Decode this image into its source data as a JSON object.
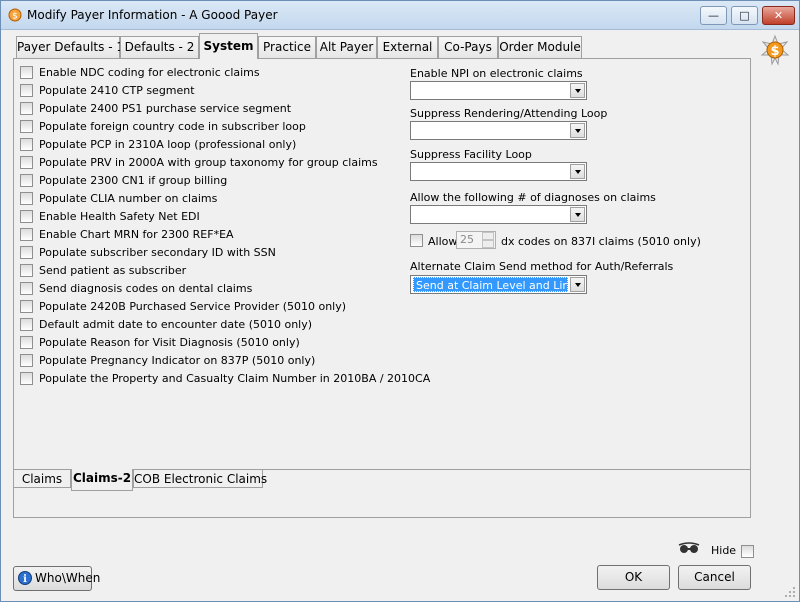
{
  "window": {
    "title": "Modify Payer Information - A Goood Payer"
  },
  "tabs": [
    {
      "label": "Payer Defaults - 1"
    },
    {
      "label": "Defaults - 2"
    },
    {
      "label": "System"
    },
    {
      "label": "Practice"
    },
    {
      "label": "Alt Payer"
    },
    {
      "label": "External"
    },
    {
      "label": "Co-Pays"
    },
    {
      "label": "Order Module"
    }
  ],
  "checkboxes": [
    {
      "label": "Enable NDC coding for electronic claims",
      "checked": false
    },
    {
      "label": "Populate 2410 CTP segment",
      "checked": false
    },
    {
      "label": "Populate 2400 PS1 purchase service segment",
      "checked": false
    },
    {
      "label": "Populate foreign country code in subscriber loop",
      "checked": false
    },
    {
      "label": "Populate PCP in 2310A loop (professional only)",
      "checked": false
    },
    {
      "label": "Populate PRV in 2000A with group taxonomy for group claims",
      "checked": false
    },
    {
      "label": "Populate 2300 CN1 if group billing",
      "checked": false
    },
    {
      "label": "Populate CLIA number on claims",
      "checked": false
    },
    {
      "label": "Enable Health Safety Net EDI",
      "checked": false
    },
    {
      "label": "Enable Chart MRN for 2300 REF*EA",
      "checked": false
    },
    {
      "label": "Populate subscriber secondary ID with SSN",
      "checked": false
    },
    {
      "label": "Send patient as subscriber",
      "checked": false
    },
    {
      "label": "Send diagnosis codes on dental claims",
      "checked": false
    },
    {
      "label": "Populate 2420B Purchased Service Provider (5010 only)",
      "checked": false
    },
    {
      "label": "Default admit date to encounter date (5010 only)",
      "checked": false
    },
    {
      "label": "Populate Reason for Visit Diagnosis (5010 only)",
      "checked": false
    },
    {
      "label": "Populate Pregnancy Indicator on 837P (5010 only)",
      "checked": false
    },
    {
      "label": "Populate the Property and Casualty Claim Number in  2010BA / 2010CA",
      "checked": false
    }
  ],
  "right": {
    "npi_label": "Enable NPI on electronic claims",
    "npi_value": "",
    "rendering_label": "Suppress Rendering/Attending Loop",
    "rendering_value": "",
    "facility_label": "Suppress Facility Loop",
    "facility_value": "",
    "diagnoses_label": "Allow the following # of diagnoses on claims",
    "diagnoses_value": "",
    "allow_label": "Allow",
    "allow_value": "25",
    "allow_suffix": "dx codes on 837I claims (5010 only)",
    "alt_send_label": "Alternate Claim Send method for Auth/Referrals",
    "alt_send_value": "Send at Claim Level and Line L"
  },
  "bottom_tabs": [
    {
      "label": "Claims"
    },
    {
      "label": "Claims-2"
    },
    {
      "label": "COB Electronic Claims"
    }
  ],
  "footer": {
    "who_when": "Who\\When",
    "hide": "Hide",
    "ok": "OK",
    "cancel": "Cancel"
  },
  "icons": [
    "app-icon",
    "dollar-badge-icon",
    "info-icon",
    "glasses-icon"
  ],
  "colors": {
    "selection": "#3399ff",
    "titlebar": "#c3d8ee"
  }
}
